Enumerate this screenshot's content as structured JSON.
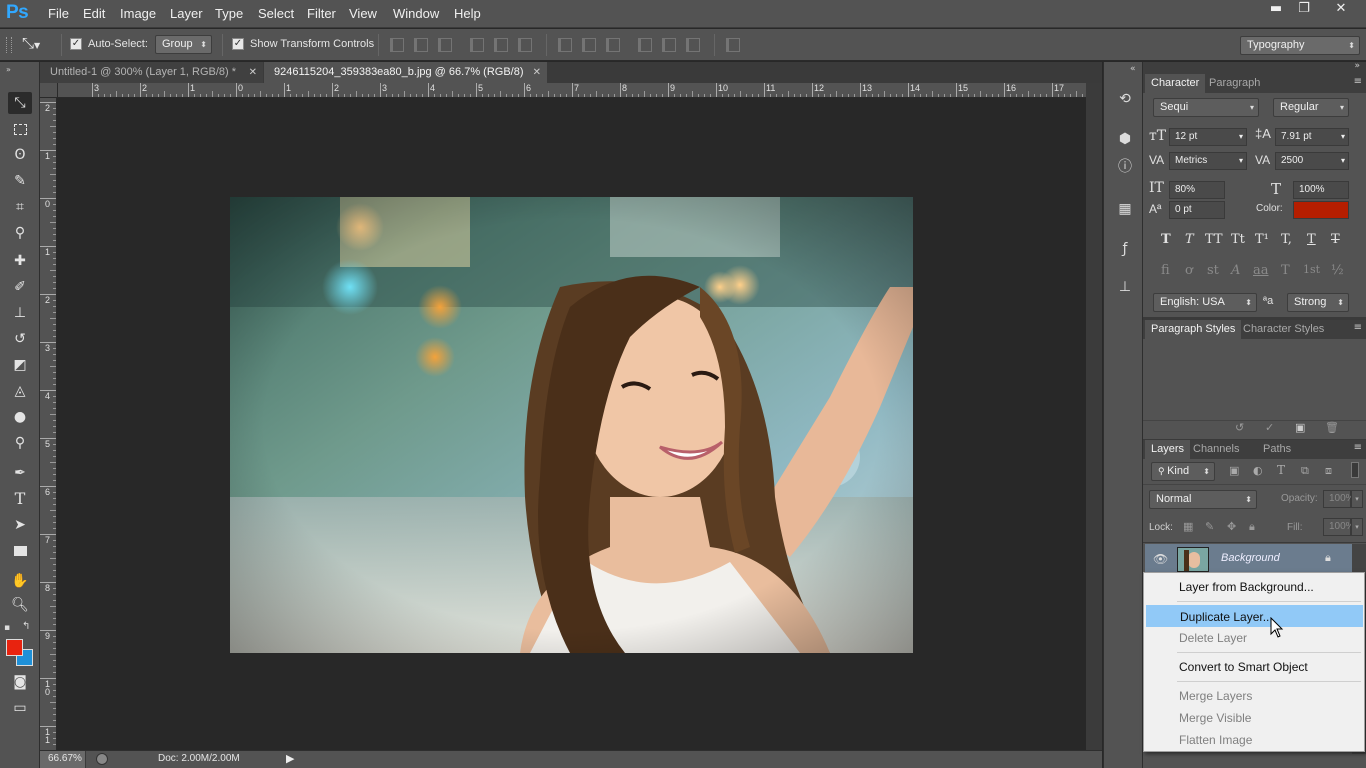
{
  "app": {
    "logo": "Ps"
  },
  "menu": [
    "File",
    "Edit",
    "Image",
    "Layer",
    "Type",
    "Select",
    "Filter",
    "View",
    "Window",
    "Help"
  ],
  "window_controls": {
    "minimize": "▬",
    "restore": "❐",
    "close": "✕"
  },
  "options_bar": {
    "auto_select_label": "Auto-Select:",
    "auto_select_checked": true,
    "auto_select_value": "Group",
    "transform_controls_label": "Show Transform Controls",
    "transform_controls_checked": true,
    "workspace": "Typography"
  },
  "doc_tabs": [
    {
      "label": "Untitled-1 @ 300% (Layer 1, RGB/8) *",
      "active": false
    },
    {
      "label": "9246115204_359383ea80_b.jpg @ 66.7% (RGB/8)",
      "active": true
    }
  ],
  "ruler_h": [
    "3",
    "2",
    "1",
    "0",
    "1",
    "2",
    "3",
    "4",
    "5",
    "6",
    "7",
    "8",
    "9",
    "10",
    "11",
    "12",
    "13",
    "14",
    "15",
    "16",
    "17"
  ],
  "ruler_v": [
    "2",
    "1",
    "0",
    "1",
    "2",
    "3",
    "4",
    "5",
    "6",
    "7",
    "8",
    "9",
    "1\n0",
    "1\n1"
  ],
  "tools": [
    "move-tool",
    "marquee-tool",
    "lasso-tool",
    "quick-select-tool",
    "crop-tool",
    "eyedropper-tool",
    "spot-healing-tool",
    "brush-tool",
    "clone-stamp-tool",
    "history-brush-tool",
    "eraser-tool",
    "paint-bucket-tool",
    "blur-tool",
    "dodge-tool",
    "pen-tool",
    "type-tool",
    "path-select-tool",
    "rectangle-tool",
    "hand-tool",
    "zoom-tool"
  ],
  "colors": {
    "foreground": "#e8230f",
    "background": "#1e90d8",
    "accent": "#31a8ff",
    "swatch_color": "#b51e00"
  },
  "status": {
    "zoom": "66.67%",
    "doc": "Doc: 2.00M/2.00M"
  },
  "character_panel": {
    "tabs": [
      "Character",
      "Paragraph"
    ],
    "font_family": "Sequi",
    "font_style": "Regular",
    "font_size": "12 pt",
    "leading": "7.91 pt",
    "kerning": "Metrics",
    "tracking": "2500",
    "vertical_scale": "80%",
    "horizontal_scale": "100%",
    "baseline_shift": "0 pt",
    "color_label": "Color:",
    "language": "English: USA",
    "antialias": "Strong",
    "aa_icon": "ªa"
  },
  "style_glyphs": [
    "T",
    "T",
    "TT",
    "Tt",
    "T¹",
    "T,",
    "T",
    "T"
  ],
  "opentype_glyphs": [
    "fi",
    "ơ",
    "st",
    "A",
    "aa",
    "T",
    "1st",
    "½"
  ],
  "paragraph_styles_tabs": [
    "Paragraph Styles",
    "Character Styles"
  ],
  "layers_panel": {
    "tabs": [
      "Layers",
      "Channels",
      "Paths"
    ],
    "kind_filter": "Kind",
    "blend_mode": "Normal",
    "opacity_label": "Opacity:",
    "opacity": "100%",
    "lock_label": "Lock:",
    "fill_label": "Fill:",
    "fill": "100%",
    "layer_name": "Background"
  },
  "context_menu": [
    {
      "label": "Layer from Background...",
      "disabled": false
    },
    {
      "label": "Duplicate Layer...",
      "disabled": false,
      "hover": true
    },
    {
      "label": "Delete Layer",
      "disabled": true
    },
    {
      "label": "Convert to Smart Object",
      "disabled": false
    },
    {
      "label": "Merge Layers",
      "disabled": true
    },
    {
      "label": "Merge Visible",
      "disabled": true
    },
    {
      "label": "Flatten Image",
      "disabled": true
    }
  ]
}
